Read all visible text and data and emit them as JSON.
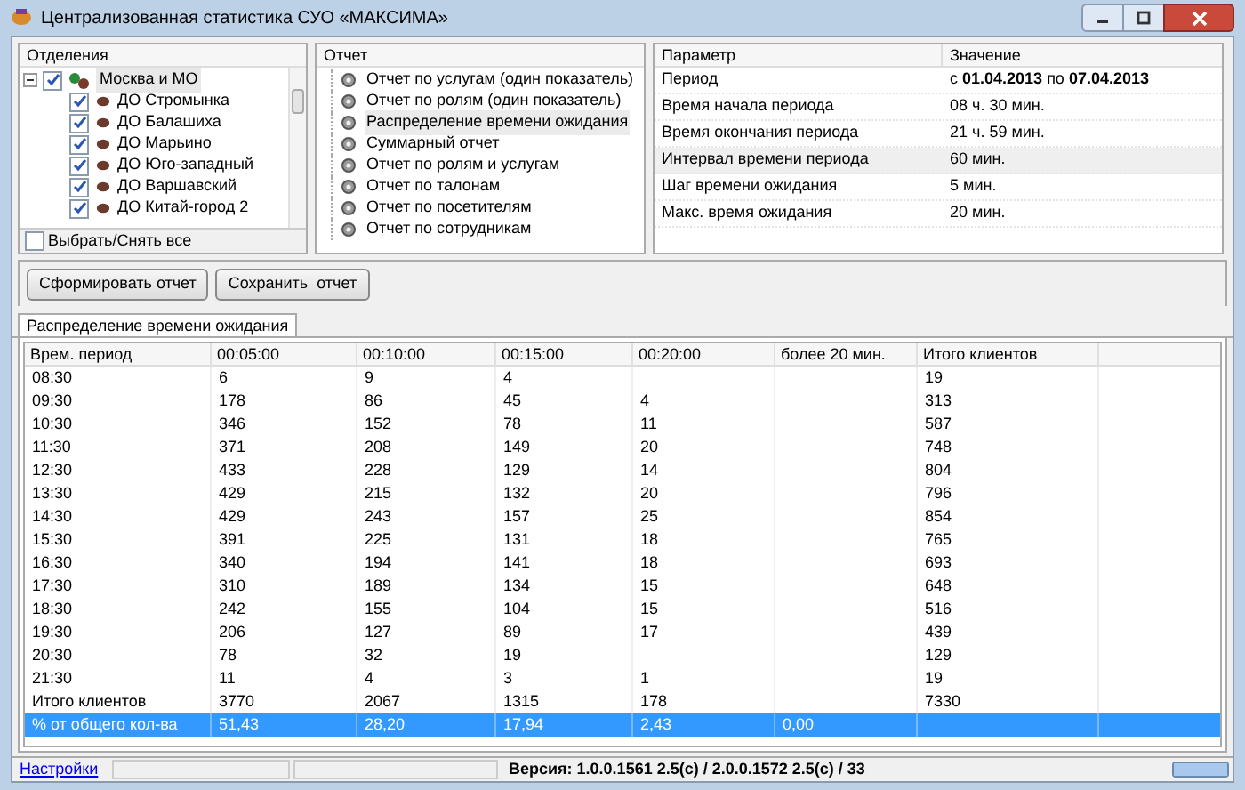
{
  "window": {
    "title": "Централизованная статистика СУО «МАКСИМА»"
  },
  "departments": {
    "header": "Отделения",
    "tree": [
      {
        "label": "Москва и МО",
        "checked": true,
        "expanded": true,
        "selected": true,
        "children": [
          {
            "label": "ДО Стромынка",
            "checked": true
          },
          {
            "label": "ДО Балашиха",
            "checked": true
          },
          {
            "label": "ДО Марьино",
            "checked": true
          },
          {
            "label": "ДО Юго-западный",
            "checked": true
          },
          {
            "label": "ДО Варшавский",
            "checked": true
          },
          {
            "label": "ДО Китай-город 2",
            "checked": true
          }
        ]
      }
    ],
    "select_all": {
      "label": "Выбрать/Снять все",
      "checked": false
    }
  },
  "reports": {
    "header": "Отчет",
    "items": [
      {
        "label": "Отчет по услугам (один показатель)",
        "selected": false
      },
      {
        "label": "Отчет по ролям (один показатель)",
        "selected": false
      },
      {
        "label": "Распределение времени ожидания",
        "selected": true
      },
      {
        "label": "Суммарный отчет",
        "selected": false
      },
      {
        "label": "Отчет по ролям и услугам",
        "selected": false
      },
      {
        "label": "Отчет по талонам",
        "selected": false
      },
      {
        "label": "Отчет по посетителям",
        "selected": false
      },
      {
        "label": "Отчет по сотрудникам",
        "selected": false
      }
    ]
  },
  "parameters": {
    "columns": [
      "Параметр",
      "Значение"
    ],
    "rows": [
      {
        "name": "Период",
        "value": "с **01.04.2013** по **07.04.2013**",
        "selected": false
      },
      {
        "name": "Время начала периода",
        "value": "08 ч. 30 мин.",
        "selected": false
      },
      {
        "name": "Время окончания периода",
        "value": "21 ч. 59 мин.",
        "selected": false
      },
      {
        "name": "Интервал времени периода",
        "value": "60 мин.",
        "selected": true
      },
      {
        "name": "Шаг времени ожидания",
        "value": "5 мин.",
        "selected": false
      },
      {
        "name": "Макс. время ожидания",
        "value": "20 мин.",
        "selected": false
      }
    ]
  },
  "buttons": [
    "Сформировать отчет",
    "Сохранить  отчет"
  ],
  "tabs": [
    {
      "label": "Распределение времени ожидания",
      "selected": true
    }
  ],
  "table": {
    "columns": [
      "Врем. период",
      "00:05:00",
      "00:10:00",
      "00:15:00",
      "00:20:00",
      "более 20 мин.",
      "Итого клиентов"
    ],
    "rows": [
      {
        "cells": [
          "08:30",
          "6",
          "9",
          "4",
          "",
          "",
          "19"
        ],
        "selected": false
      },
      {
        "cells": [
          "09:30",
          "178",
          "86",
          "45",
          "4",
          "",
          "313"
        ],
        "selected": false
      },
      {
        "cells": [
          "10:30",
          "346",
          "152",
          "78",
          "11",
          "",
          "587"
        ],
        "selected": false
      },
      {
        "cells": [
          "11:30",
          "371",
          "208",
          "149",
          "20",
          "",
          "748"
        ],
        "selected": false
      },
      {
        "cells": [
          "12:30",
          "433",
          "228",
          "129",
          "14",
          "",
          "804"
        ],
        "selected": false
      },
      {
        "cells": [
          "13:30",
          "429",
          "215",
          "132",
          "20",
          "",
          "796"
        ],
        "selected": false
      },
      {
        "cells": [
          "14:30",
          "429",
          "243",
          "157",
          "25",
          "",
          "854"
        ],
        "selected": false
      },
      {
        "cells": [
          "15:30",
          "391",
          "225",
          "131",
          "18",
          "",
          "765"
        ],
        "selected": false
      },
      {
        "cells": [
          "16:30",
          "340",
          "194",
          "141",
          "18",
          "",
          "693"
        ],
        "selected": false
      },
      {
        "cells": [
          "17:30",
          "310",
          "189",
          "134",
          "15",
          "",
          "648"
        ],
        "selected": false
      },
      {
        "cells": [
          "18:30",
          "242",
          "155",
          "104",
          "15",
          "",
          "516"
        ],
        "selected": false
      },
      {
        "cells": [
          "19:30",
          "206",
          "127",
          "89",
          "17",
          "",
          "439"
        ],
        "selected": false
      },
      {
        "cells": [
          "20:30",
          "78",
          "32",
          "19",
          "",
          "",
          "129"
        ],
        "selected": false
      },
      {
        "cells": [
          "21:30",
          "11",
          "4",
          "3",
          "1",
          "",
          "19"
        ],
        "selected": false
      },
      {
        "cells": [
          "Итого клиентов",
          "3770",
          "2067",
          "1315",
          "178",
          "",
          "7330"
        ],
        "selected": false
      },
      {
        "cells": [
          "% от общего кол-ва",
          "51,43",
          "28,20",
          "17,94",
          "2,43",
          "0,00",
          ""
        ],
        "selected": true
      }
    ]
  },
  "status_bar": {
    "link": "Настройки",
    "progress": {
      "level": 1
    },
    "version": "Версия: 1.0.0.1561 2.5(с) / 2.0.0.1572 2.5(с) / 33"
  }
}
